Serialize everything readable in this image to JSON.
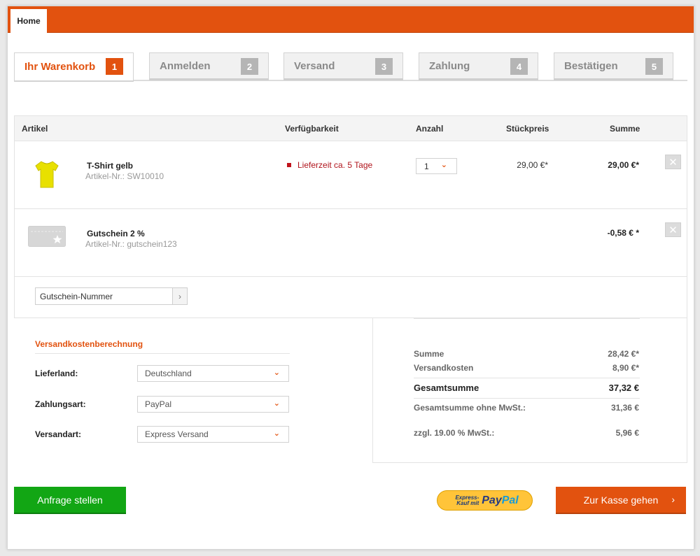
{
  "header": {
    "home_tab": "Home"
  },
  "steps": [
    {
      "label": "Ihr Warenkorb",
      "num": "1"
    },
    {
      "label": "Anmelden",
      "num": "2"
    },
    {
      "label": "Versand",
      "num": "3"
    },
    {
      "label": "Zahlung",
      "num": "4"
    },
    {
      "label": "Bestätigen",
      "num": "5"
    }
  ],
  "cart": {
    "columns": {
      "article": "Artikel",
      "availability": "Verfügbarkeit",
      "quantity": "Anzahl",
      "unit_price": "Stückpreis",
      "sum": "Summe"
    },
    "items": [
      {
        "title": "T-Shirt gelb",
        "artnr": "Artikel-Nr.: SW10010",
        "availability": "Lieferzeit ca. 5 Tage",
        "qty": "1",
        "unit_price": "29,00 €*",
        "sum": "29,00 €*",
        "delete": "✕"
      },
      {
        "title": "Gutschein 2 %",
        "artnr": "Artikel-Nr.: gutschein123",
        "sum": "-0,58 € *",
        "delete": "✕"
      }
    ],
    "voucher": {
      "value": "Gutschein-Nummer",
      "button": "›"
    }
  },
  "shipping": {
    "title": "Versandkostenberechnung",
    "country_label": "Lieferland:",
    "country_value": "Deutschland",
    "payment_label": "Zahlungsart:",
    "payment_value": "PayPal",
    "method_label": "Versandart:",
    "method_value": "Express Versand"
  },
  "totals": {
    "sum_label": "Summe",
    "sum_value": "28,42 €*",
    "shipping_label": "Versandkosten",
    "shipping_value": "8,90 €*",
    "total_label": "Gesamtsumme",
    "total_value": "37,32 €",
    "net_label": "Gesamtsumme ohne MwSt.:",
    "net_value": "31,36 €",
    "vat_label": "zzgl. 19.00 % MwSt.:",
    "vat_value": "5,96 €"
  },
  "actions": {
    "request": "Anfrage stellen",
    "paypal_small": "Express-Kauf mit",
    "paypal_logo_a": "Pay",
    "paypal_logo_b": "Pal",
    "checkout": "Zur Kasse gehen",
    "checkout_arrow": "›"
  },
  "colors": {
    "accent": "#e2520f",
    "green": "#12a614",
    "availability": "#b0141c"
  }
}
